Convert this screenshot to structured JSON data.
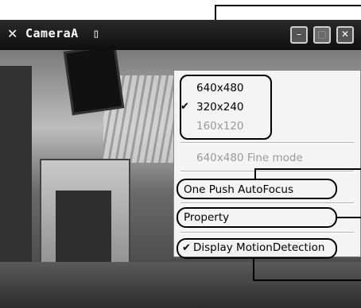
{
  "window": {
    "title": "CameraA",
    "title_glyph": "▯"
  },
  "titlebar_buttons": {
    "minimize": "–",
    "maximize": "▢",
    "close": "✕"
  },
  "menu": {
    "resolutions": [
      {
        "label": "640x480",
        "checked": false,
        "disabled": false
      },
      {
        "label": "320x240",
        "checked": true,
        "disabled": false
      },
      {
        "label": "160x120",
        "checked": false,
        "disabled": true
      }
    ],
    "fine_mode": {
      "label": "640x480 Fine mode",
      "disabled": true
    },
    "autofocus": {
      "label": "One Push AutoFocus"
    },
    "property": {
      "label": "Property"
    },
    "motion": {
      "label": "Display MotionDetection",
      "checked": true
    },
    "checkmark": "✔"
  },
  "icons": [
    "app-icon",
    "minimize-icon",
    "maximize-icon",
    "close-icon",
    "check-icon"
  ]
}
